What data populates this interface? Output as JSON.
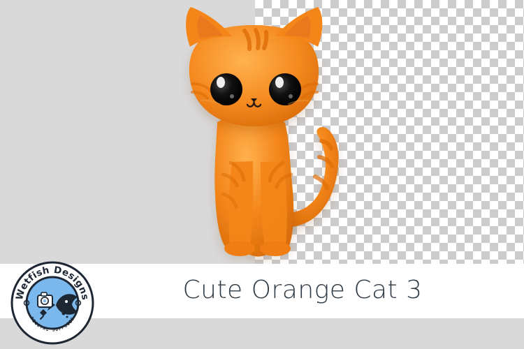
{
  "image": {
    "title": "Cute Orange Cat 3",
    "background_colors": {
      "left_panel": "#d9d9d9",
      "checker_light": "#ffffff",
      "checker_dark": "#cccccc",
      "title_panel": "#ffffff",
      "cat_orange": "#f2841b",
      "cat_stripes": "#e06f08",
      "eye_dark": "#111111"
    },
    "icons": {
      "cat": "orange-cat-illustration",
      "logo": "wetfish-designs-badge",
      "transparency_grid": "checkerboard-pattern"
    }
  },
  "brand": {
    "name": "Wetfish Designs",
    "tagline": "DIGITAL SUPPLIES"
  }
}
